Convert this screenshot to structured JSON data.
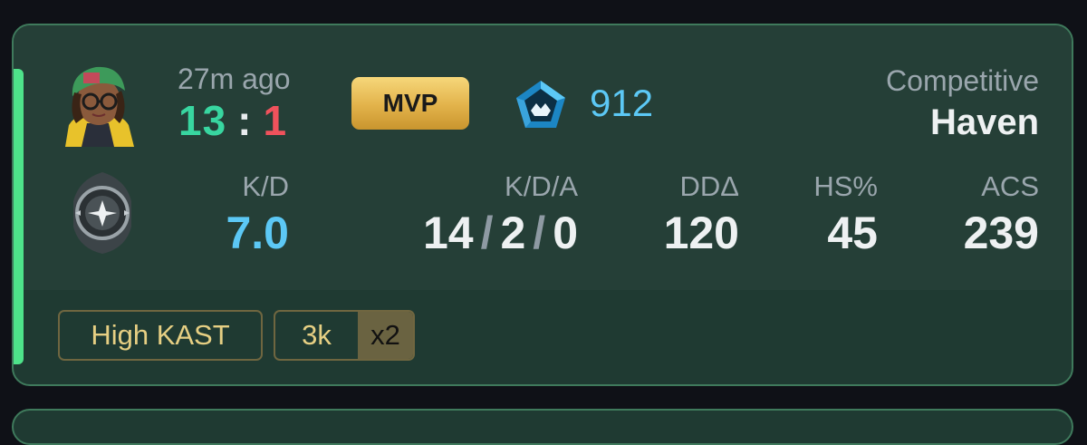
{
  "match": {
    "time_ago": "27m ago",
    "score_won": "13",
    "score_sep": ":",
    "score_lost": "1",
    "mvp_label": "MVP",
    "rank_value": "912",
    "mode": "Competitive",
    "map": "Haven"
  },
  "stats": {
    "kd_label": "K/D",
    "kd_value": "7.0",
    "kda_label": "K/D/A",
    "kills": "14",
    "deaths": "2",
    "assists": "0",
    "slash": "/",
    "dda_label": "DDΔ",
    "dda_value": "120",
    "hs_label": "HS%",
    "hs_value": "45",
    "acs_label": "ACS",
    "acs_value": "239"
  },
  "tags": {
    "kast": "High KAST",
    "multikill": "3k",
    "multiplier": "x2"
  },
  "colors": {
    "win_accent": "#4ee38a",
    "score_won": "#38d6a0",
    "score_lost": "#f0525c",
    "rank_blue": "#5cc8f5",
    "tag_gold": "#e6cf83"
  },
  "icons": {
    "agent": "agent-avatar-icon",
    "rank": "rank-emblem-icon",
    "rr": "radiant-rank-icon"
  }
}
